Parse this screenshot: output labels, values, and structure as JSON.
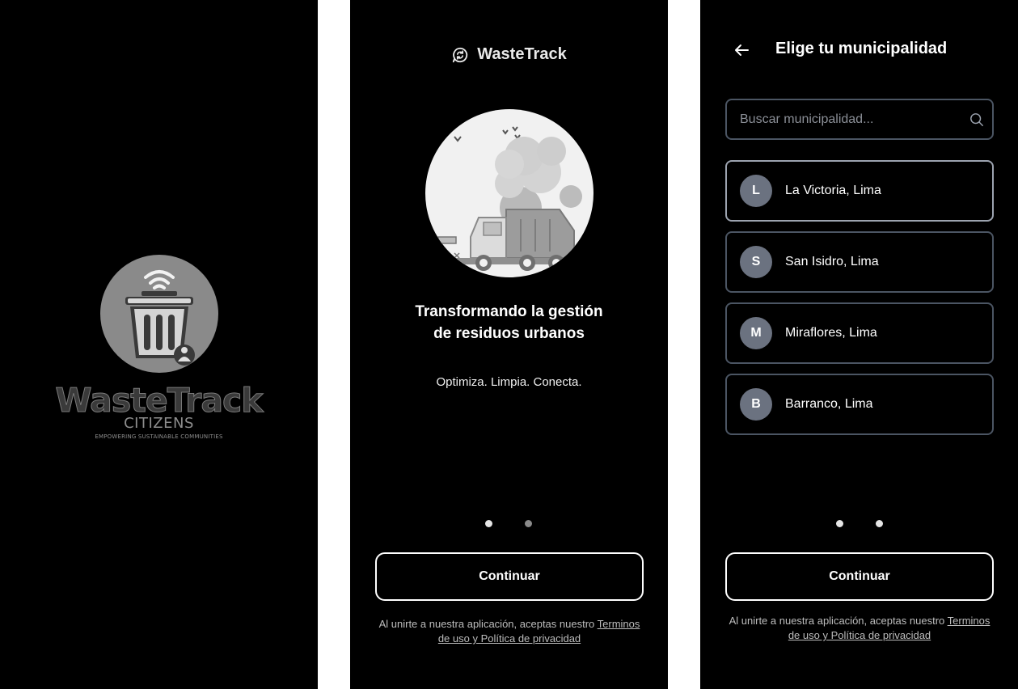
{
  "splash": {
    "logo_title": "WasteTrack",
    "logo_subtitle": "CITIZENS",
    "logo_tagline": "EMPOWERING SUSTAINABLE COMMUNITIES"
  },
  "onboarding": {
    "brand_name": "WasteTrack",
    "headline_line1": "Transformando la gestión",
    "headline_line2": "de residuos urbanos",
    "tagline": "Optimiza. Limpia. Conecta.",
    "continue_label": "Continuar",
    "legal_prefix": "Al unirte a nuestra aplicación, aceptas nuestro ",
    "legal_link": "Terminos de uso y Política de privacidad",
    "pagination": {
      "total": 2,
      "active": 1
    }
  },
  "municipality": {
    "title": "Elige tu municipalidad",
    "search_placeholder": "Buscar municipalidad...",
    "items": [
      {
        "initial": "L",
        "name": "La Victoria, Lima"
      },
      {
        "initial": "S",
        "name": "San Isidro, Lima"
      },
      {
        "initial": "M",
        "name": "Miraflores, Lima"
      },
      {
        "initial": "B",
        "name": "Barranco, Lima"
      }
    ],
    "continue_label": "Continuar",
    "legal_prefix": "Al unirte a nuestra aplicación, aceptas nuestro ",
    "legal_link": "Terminos de uso y Política de privacidad",
    "pagination": {
      "total": 2,
      "active": 2
    }
  },
  "colors": {
    "background": "#000000",
    "border": "#4b5563",
    "avatar": "#6b7280",
    "dot_active": "#e5e5e5",
    "dot_inactive": "#8a8a8a"
  },
  "icons": {
    "brand": "recycle-chat-icon",
    "back": "arrow-left-icon",
    "search": "search-icon"
  }
}
